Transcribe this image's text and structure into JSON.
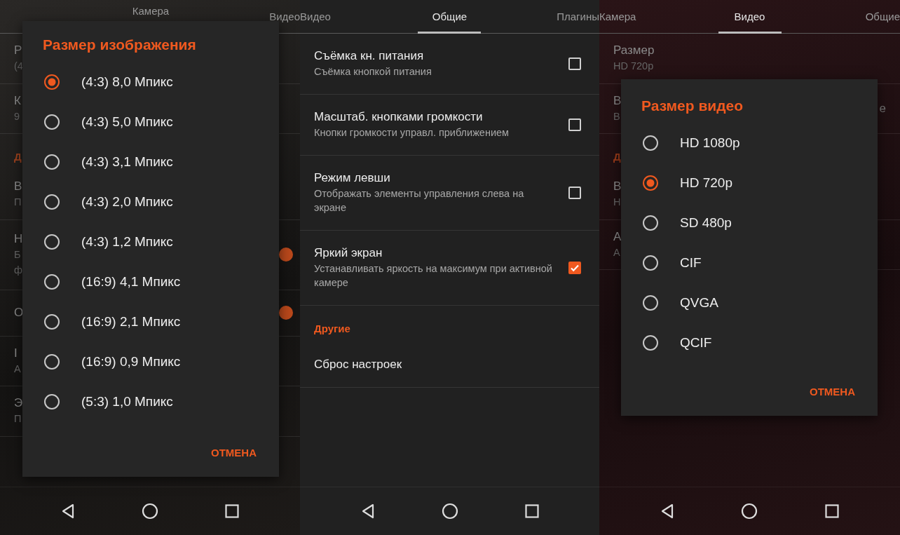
{
  "screens": [
    {
      "kind": "dialog",
      "tabs": [
        {
          "label": "Камера",
          "selected": false
        },
        {
          "label": "Видео",
          "selected": false
        }
      ],
      "rows": [
        {
          "kind": "row",
          "title": "Р",
          "summary": "(4"
        },
        {
          "kind": "row",
          "title": "К",
          "summary": "9"
        },
        {
          "kind": "header",
          "title": "Д"
        },
        {
          "kind": "row",
          "title": "В",
          "summary": "П"
        },
        {
          "kind": "row",
          "title": "Н",
          "summary": "Б",
          "extra": "ф",
          "on": true
        },
        {
          "kind": "row",
          "title": "О",
          "on": true
        },
        {
          "kind": "row",
          "title": "I",
          "summary": "А"
        },
        {
          "kind": "row",
          "title": "Э",
          "summary": "П"
        }
      ],
      "dialog": {
        "title": "Размер изображения",
        "options": [
          {
            "label": "(4:3) 8,0 Мпикс",
            "selected": true
          },
          {
            "label": "(4:3) 5,0 Мпикс",
            "selected": false
          },
          {
            "label": "(4:3) 3,1 Мпикс",
            "selected": false
          },
          {
            "label": "(4:3) 2,0 Мпикс",
            "selected": false
          },
          {
            "label": "(4:3) 1,2 Мпикс",
            "selected": false
          },
          {
            "label": "(16:9) 4,1 Мпикс",
            "selected": false
          },
          {
            "label": "(16:9) 2,1 Мпикс",
            "selected": false
          },
          {
            "label": "(16:9) 0,9 Мпикс",
            "selected": false
          },
          {
            "label": "(5:3) 1,0 Мпикс",
            "selected": false
          }
        ],
        "cancel": "ОТМЕНА"
      }
    },
    {
      "kind": "list",
      "tabs": [
        {
          "label": "Видео",
          "selected": false
        },
        {
          "label": "Общие",
          "selected": true
        },
        {
          "label": "Плагины",
          "selected": false
        }
      ],
      "rows": [
        {
          "kind": "checkbox",
          "title": "Съёмка кн. питания",
          "summary": "Съёмка кнопкой питания",
          "checked": false
        },
        {
          "kind": "checkbox",
          "title": "Масштаб. кнопками громкости",
          "summary": "Кнопки громкости управл. приближением",
          "checked": false
        },
        {
          "kind": "checkbox",
          "title": "Режим левши",
          "summary": "Отображать элементы управления слева на экране",
          "checked": false
        },
        {
          "kind": "checkbox",
          "title": "Яркий экран",
          "summary": "Устанавливать яркость на максимум при активной камере",
          "checked": true
        },
        {
          "kind": "header",
          "title": "Другие"
        },
        {
          "kind": "row",
          "title": "Сброс настроек"
        }
      ]
    },
    {
      "kind": "dialog",
      "tabs": [
        {
          "label": "Камера",
          "selected": false
        },
        {
          "label": "Видео",
          "selected": true
        },
        {
          "label": "Общие",
          "selected": false
        }
      ],
      "rows": [
        {
          "kind": "row",
          "title": "Размер",
          "summary": "HD 720p"
        },
        {
          "kind": "row",
          "title": "В",
          "summary": "В",
          "trailing": "е"
        },
        {
          "kind": "header",
          "title": "Д"
        },
        {
          "kind": "row",
          "title": "В",
          "summary": "Н"
        },
        {
          "kind": "row",
          "title": "А",
          "summary": "А"
        }
      ],
      "dialog": {
        "title": "Размер видео",
        "options": [
          {
            "label": "HD 1080p",
            "selected": false
          },
          {
            "label": "HD 720p",
            "selected": true
          },
          {
            "label": "SD 480p",
            "selected": false
          },
          {
            "label": "CIF",
            "selected": false
          },
          {
            "label": "QVGA",
            "selected": false
          },
          {
            "label": "QCIF",
            "selected": false
          }
        ],
        "cancel": "ОТМЕНА"
      }
    }
  ]
}
